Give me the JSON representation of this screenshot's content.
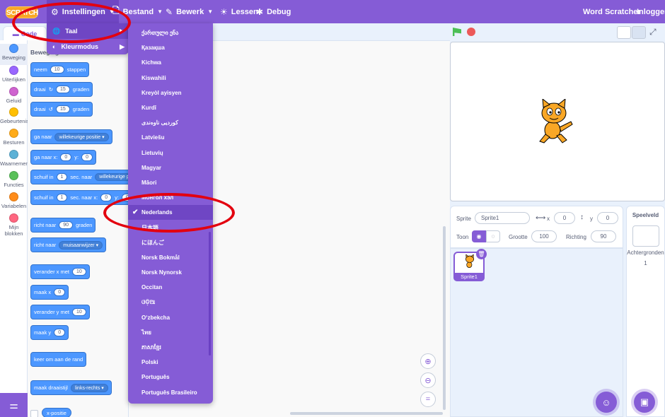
{
  "menubar": {
    "logo_text": "SCRATCH",
    "settings": "Instellingen",
    "file": "Bestand",
    "edit": "Bewerk",
    "tutorials": "Lessen",
    "debug": "Debug",
    "join": "Word Scratcher",
    "signin": "Inloggen"
  },
  "settings_menu": {
    "language": "Taal",
    "theme": "Kleurmodus"
  },
  "languages": [
    "ქართული ენა",
    "Қазақша",
    "Kichwa",
    "Kiswahili",
    "Kreyòl ayisyen",
    "Kurdî",
    "کوردیی ناوەندی",
    "Latviešu",
    "Lietuvių",
    "Magyar",
    "Māori",
    "Монгол хэл",
    "Nederlands",
    "日本語",
    "にほんご",
    "Norsk Bokmål",
    "Norsk Nynorsk",
    "Occitan",
    "ଓଡ଼ିଆ",
    "O‘zbekcha",
    "ไทย",
    "ភាសាខ្មែរ",
    "Polski",
    "Português",
    "Português Brasileiro"
  ],
  "selected_language": "Nederlands",
  "tabs": {
    "code": "Code"
  },
  "categories": [
    {
      "label": "Beweging",
      "color": "#4c97ff"
    },
    {
      "label": "Uiterlijken",
      "color": "#9966ff"
    },
    {
      "label": "Geluid",
      "color": "#cf63cf"
    },
    {
      "label": "Gebeurtenissen",
      "color": "#ffbf00"
    },
    {
      "label": "Besturen",
      "color": "#ffab19"
    },
    {
      "label": "Waarnemen",
      "color": "#5cb1d6"
    },
    {
      "label": "Functies",
      "color": "#59c059"
    },
    {
      "label": "Variabelen",
      "color": "#ff8c1a"
    },
    {
      "label": "Mijn blokken",
      "color": "#ff6680"
    }
  ],
  "palette": {
    "title": "Beweging",
    "move_a": "neem",
    "move_steps": "10",
    "move_b": "stappen",
    "turn_a": "draai",
    "turn_deg": "15",
    "turn_b": "graden",
    "goto_a": "ga naar",
    "goto_dd": "willekeurige positie",
    "gotoxy_a": "ga naar x:",
    "gotoxy_x": "0",
    "gotoxy_y_lbl": "y:",
    "gotoxy_y": "0",
    "glide_a": "schuif in",
    "glide_secs": "1",
    "glide_b": "sec. naar",
    "glide_dd": "willekeurige pos",
    "glidexy_a": "schuif in",
    "glidexy_secs": "1",
    "glidexy_b": "sec. naar x:",
    "glidexy_x": "0",
    "glidexy_y_lbl": "y:",
    "glidexy_y": "0",
    "point_a": "richt naar",
    "point_deg": "90",
    "point_b": "graden",
    "pointto_a": "richt naar",
    "pointto_dd": "muisaanwijzer",
    "changex_a": "verander x met",
    "changex_v": "10",
    "setx_a": "maak x",
    "setx_v": "0",
    "changey_a": "verander y met",
    "changey_v": "10",
    "sety_a": "maak y",
    "sety_v": "0",
    "bounce": "keer om aan de rand",
    "rot_a": "maak draaistijl",
    "rot_dd": "links-rechts",
    "xpos": "x-positie"
  },
  "sprite": {
    "label": "Sprite",
    "name": "Sprite1",
    "x_label": "x",
    "x": "0",
    "y_label": "y",
    "y": "0",
    "show_label": "Toon",
    "size_label": "Grootte",
    "size": "100",
    "direction_label": "Richting",
    "direction": "90",
    "tile_name": "Sprite1"
  },
  "stage_pane": {
    "title": "Speelveld",
    "backdrops_label": "Achtergronden",
    "backdrops_count": "1"
  },
  "colors": {
    "accent": "#855cd6",
    "motion": "#4c97ff",
    "annotation": "#e3000f"
  }
}
